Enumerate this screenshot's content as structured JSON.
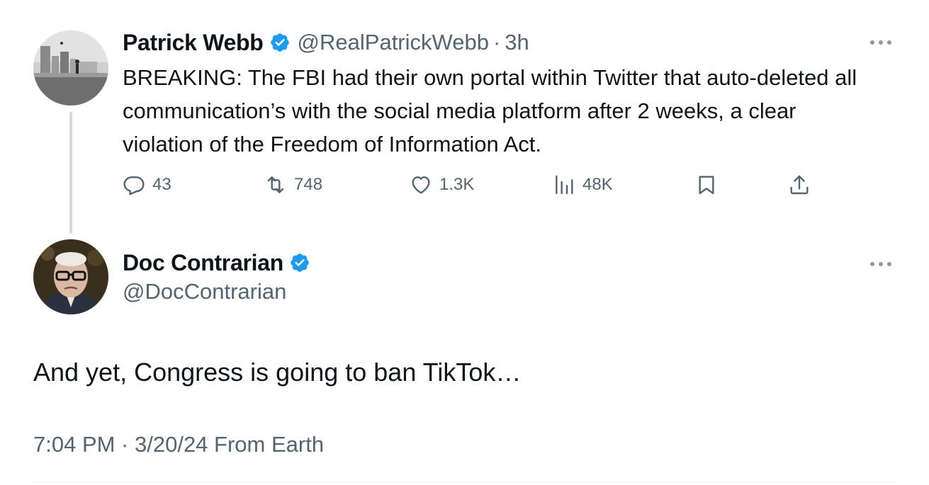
{
  "parent_tweet": {
    "author_name": "Patrick Webb",
    "handle": "@RealPatrickWebb",
    "separator": "·",
    "time": "3h",
    "text": "BREAKING: The FBI had their own portal within Twitter that auto-deleted all communication’s with the social media platform after 2 weeks, a clear violation of the Freedom of Information Act.",
    "actions": {
      "replies": "43",
      "reposts": "748",
      "likes": "1.3K",
      "views": "48K"
    },
    "icons": {
      "reply": "reply-icon",
      "repost": "repost-icon",
      "like": "heart-icon",
      "views": "views-icon",
      "bookmark": "bookmark-icon",
      "share": "share-icon",
      "more": "more-icon",
      "verified": "verified-badge-icon"
    }
  },
  "reply_tweet": {
    "author_name": "Doc Contrarian",
    "handle": "@DocContrarian",
    "text": "And yet, Congress is going to ban TikTok…",
    "meta": "7:04 PM · 3/20/24 From Earth"
  },
  "colors": {
    "text_primary": "#0f1419",
    "text_secondary": "#536471",
    "verified_blue": "#1d9bf0",
    "thread_line": "#cfd9de"
  }
}
